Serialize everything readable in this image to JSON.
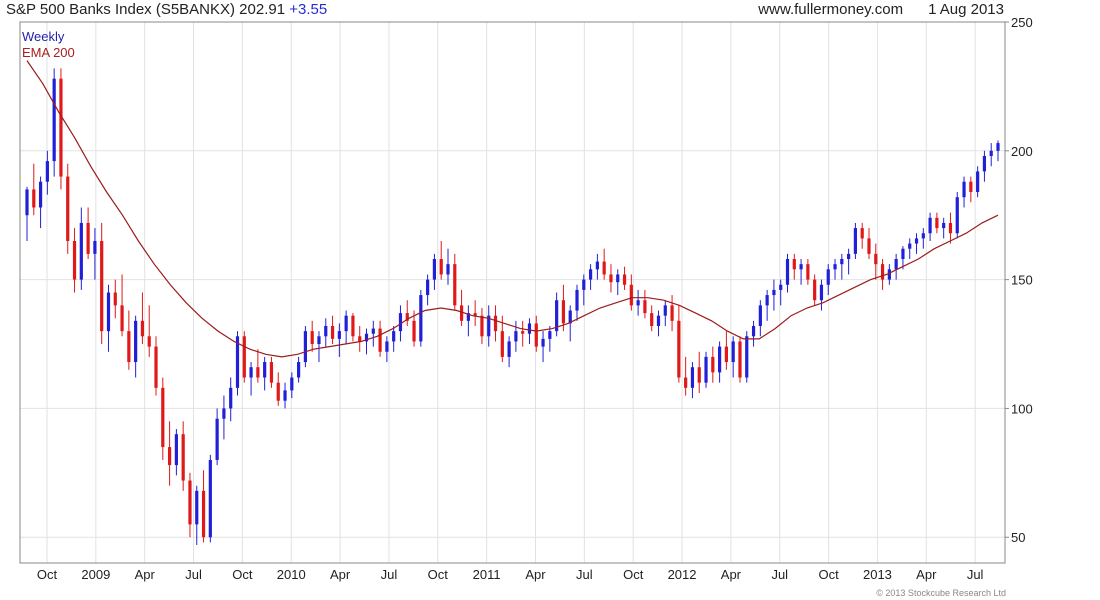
{
  "header": {
    "title": "S&P 500 Banks Index (S5BANKX) 202.91",
    "change": "+3.55",
    "website": "www.fullermoney.com",
    "date": "1 Aug 2013"
  },
  "legend": {
    "line1": "Weekly",
    "line2": "EMA 200"
  },
  "copyright": "© 2013 Stockcube Research Ltd",
  "colors": {
    "up": "#2020d8",
    "down": "#e01818",
    "ema": "#9b1c1c",
    "grid": "#e2e2e2"
  },
  "chart_data": {
    "type": "candlestick",
    "y_axis": {
      "position": "right",
      "ylim": [
        40,
        250
      ],
      "ticks": [
        50,
        100,
        150,
        200,
        250
      ]
    },
    "x_axis": {
      "tick_labels": [
        "Oct",
        "2009",
        "Apr",
        "Jul",
        "Oct",
        "2010",
        "Apr",
        "Jul",
        "Oct",
        "2011",
        "Apr",
        "Jul",
        "Oct",
        "2012",
        "Apr",
        "Jul",
        "Oct",
        "2013",
        "Apr",
        "Jul"
      ]
    },
    "grid": true,
    "series": [
      {
        "name": "Weekly",
        "type": "candlestick",
        "ohlc": [
          [
            175,
            186,
            165,
            185
          ],
          [
            185,
            195,
            175,
            178
          ],
          [
            178,
            190,
            170,
            188
          ],
          [
            188,
            200,
            183,
            196
          ],
          [
            196,
            232,
            190,
            228
          ],
          [
            228,
            232,
            185,
            190
          ],
          [
            190,
            195,
            160,
            165
          ],
          [
            165,
            170,
            145,
            150
          ],
          [
            150,
            178,
            146,
            172
          ],
          [
            172,
            178,
            158,
            160
          ],
          [
            160,
            170,
            150,
            165
          ],
          [
            165,
            172,
            125,
            130
          ],
          [
            130,
            148,
            122,
            145
          ],
          [
            145,
            150,
            135,
            140
          ],
          [
            140,
            152,
            128,
            130
          ],
          [
            130,
            138,
            115,
            118
          ],
          [
            118,
            136,
            112,
            134
          ],
          [
            134,
            145,
            125,
            128
          ],
          [
            128,
            140,
            120,
            124
          ],
          [
            124,
            128,
            105,
            108
          ],
          [
            108,
            112,
            80,
            85
          ],
          [
            85,
            95,
            70,
            78
          ],
          [
            78,
            92,
            74,
            90
          ],
          [
            90,
            95,
            68,
            72
          ],
          [
            72,
            75,
            50,
            55
          ],
          [
            55,
            70,
            47,
            68
          ],
          [
            68,
            76,
            48,
            50
          ],
          [
            50,
            82,
            48,
            80
          ],
          [
            80,
            100,
            78,
            96
          ],
          [
            96,
            105,
            88,
            100
          ],
          [
            100,
            112,
            95,
            108
          ],
          [
            108,
            130,
            105,
            128
          ],
          [
            128,
            130,
            110,
            112
          ],
          [
            112,
            118,
            105,
            116
          ],
          [
            116,
            123,
            110,
            112
          ],
          [
            112,
            120,
            107,
            118
          ],
          [
            118,
            120,
            108,
            110
          ],
          [
            110,
            114,
            101,
            103
          ],
          [
            103,
            110,
            100,
            107
          ],
          [
            107,
            114,
            104,
            112
          ],
          [
            112,
            120,
            110,
            118
          ],
          [
            118,
            132,
            116,
            130
          ],
          [
            130,
            134,
            122,
            125
          ],
          [
            125,
            130,
            118,
            128
          ],
          [
            128,
            135,
            124,
            132
          ],
          [
            132,
            136,
            125,
            127
          ],
          [
            127,
            133,
            120,
            130
          ],
          [
            130,
            138,
            125,
            136
          ],
          [
            136,
            137,
            126,
            128
          ],
          [
            128,
            132,
            122,
            126
          ],
          [
            126,
            131,
            121,
            129
          ],
          [
            129,
            134,
            124,
            131
          ],
          [
            131,
            134,
            120,
            122
          ],
          [
            122,
            128,
            118,
            126
          ],
          [
            126,
            132,
            122,
            130
          ],
          [
            130,
            140,
            126,
            137
          ],
          [
            137,
            142,
            132,
            134
          ],
          [
            134,
            138,
            124,
            126
          ],
          [
            126,
            146,
            124,
            144
          ],
          [
            144,
            152,
            140,
            150
          ],
          [
            150,
            160,
            146,
            158
          ],
          [
            158,
            165,
            150,
            152
          ],
          [
            152,
            162,
            148,
            156
          ],
          [
            156,
            160,
            138,
            140
          ],
          [
            140,
            146,
            132,
            134
          ],
          [
            134,
            140,
            128,
            137
          ],
          [
            137,
            142,
            132,
            136
          ],
          [
            136,
            139,
            125,
            128
          ],
          [
            128,
            140,
            124,
            136
          ],
          [
            136,
            140,
            126,
            130
          ],
          [
            130,
            136,
            118,
            120
          ],
          [
            120,
            128,
            116,
            126
          ],
          [
            126,
            134,
            122,
            130
          ],
          [
            130,
            134,
            124,
            129
          ],
          [
            129,
            135,
            125,
            133
          ],
          [
            133,
            136,
            122,
            124
          ],
          [
            124,
            130,
            118,
            127
          ],
          [
            127,
            132,
            122,
            130
          ],
          [
            130,
            145,
            128,
            142
          ],
          [
            142,
            148,
            130,
            133
          ],
          [
            133,
            140,
            126,
            138
          ],
          [
            138,
            148,
            134,
            146
          ],
          [
            146,
            152,
            140,
            150
          ],
          [
            150,
            156,
            146,
            154
          ],
          [
            154,
            160,
            150,
            157
          ],
          [
            157,
            162,
            150,
            152
          ],
          [
            152,
            156,
            145,
            149
          ],
          [
            149,
            154,
            144,
            152
          ],
          [
            152,
            155,
            146,
            148
          ],
          [
            148,
            152,
            138,
            140
          ],
          [
            140,
            146,
            136,
            142
          ],
          [
            142,
            146,
            135,
            137
          ],
          [
            137,
            140,
            130,
            132
          ],
          [
            132,
            138,
            128,
            136
          ],
          [
            136,
            142,
            132,
            140
          ],
          [
            140,
            144,
            130,
            134
          ],
          [
            134,
            140,
            110,
            112
          ],
          [
            112,
            120,
            105,
            108
          ],
          [
            108,
            118,
            104,
            116
          ],
          [
            116,
            122,
            106,
            110
          ],
          [
            110,
            122,
            108,
            120
          ],
          [
            120,
            124,
            110,
            114
          ],
          [
            114,
            126,
            110,
            124
          ],
          [
            124,
            130,
            115,
            118
          ],
          [
            118,
            128,
            112,
            126
          ],
          [
            126,
            128,
            110,
            112
          ],
          [
            112,
            130,
            110,
            128
          ],
          [
            128,
            134,
            124,
            132
          ],
          [
            132,
            142,
            128,
            140
          ],
          [
            140,
            146,
            134,
            144
          ],
          [
            144,
            150,
            138,
            146
          ],
          [
            146,
            150,
            140,
            148
          ],
          [
            148,
            160,
            145,
            158
          ],
          [
            158,
            160,
            150,
            154
          ],
          [
            154,
            158,
            148,
            156
          ],
          [
            156,
            158,
            148,
            150
          ],
          [
            150,
            152,
            140,
            142
          ],
          [
            142,
            150,
            138,
            148
          ],
          [
            148,
            156,
            144,
            154
          ],
          [
            154,
            158,
            150,
            156
          ],
          [
            156,
            160,
            150,
            158
          ],
          [
            158,
            162,
            152,
            160
          ],
          [
            160,
            172,
            158,
            170
          ],
          [
            170,
            172,
            162,
            166
          ],
          [
            166,
            170,
            158,
            160
          ],
          [
            160,
            164,
            150,
            156
          ],
          [
            156,
            158,
            146,
            150
          ],
          [
            150,
            156,
            148,
            154
          ],
          [
            154,
            160,
            150,
            158
          ],
          [
            158,
            163,
            154,
            162
          ],
          [
            162,
            166,
            158,
            164
          ],
          [
            164,
            168,
            160,
            166
          ],
          [
            166,
            170,
            162,
            168
          ],
          [
            168,
            176,
            165,
            174
          ],
          [
            174,
            176,
            168,
            170
          ],
          [
            170,
            174,
            166,
            172
          ],
          [
            172,
            176,
            164,
            168
          ],
          [
            168,
            184,
            166,
            182
          ],
          [
            182,
            190,
            178,
            188
          ],
          [
            188,
            190,
            180,
            184
          ],
          [
            184,
            194,
            182,
            192
          ],
          [
            192,
            200,
            188,
            198
          ],
          [
            198,
            203,
            194,
            200
          ],
          [
            200,
            204,
            196,
            203
          ]
        ]
      },
      {
        "name": "EMA 200",
        "type": "line",
        "values": [
          235,
          226,
          215,
          205,
          194,
          184,
          175,
          165,
          156,
          148,
          141,
          135,
          130,
          126,
          123,
          121,
          120,
          121,
          123,
          124,
          125,
          126,
          128,
          131,
          135,
          138,
          139,
          138,
          136,
          135,
          133,
          131,
          130,
          131,
          133,
          136,
          139,
          141,
          143,
          143,
          142,
          140,
          137,
          134,
          130,
          127,
          127,
          131,
          136,
          139,
          141,
          144,
          147,
          150,
          152,
          155,
          158,
          162,
          165,
          168,
          172,
          175
        ]
      }
    ]
  }
}
